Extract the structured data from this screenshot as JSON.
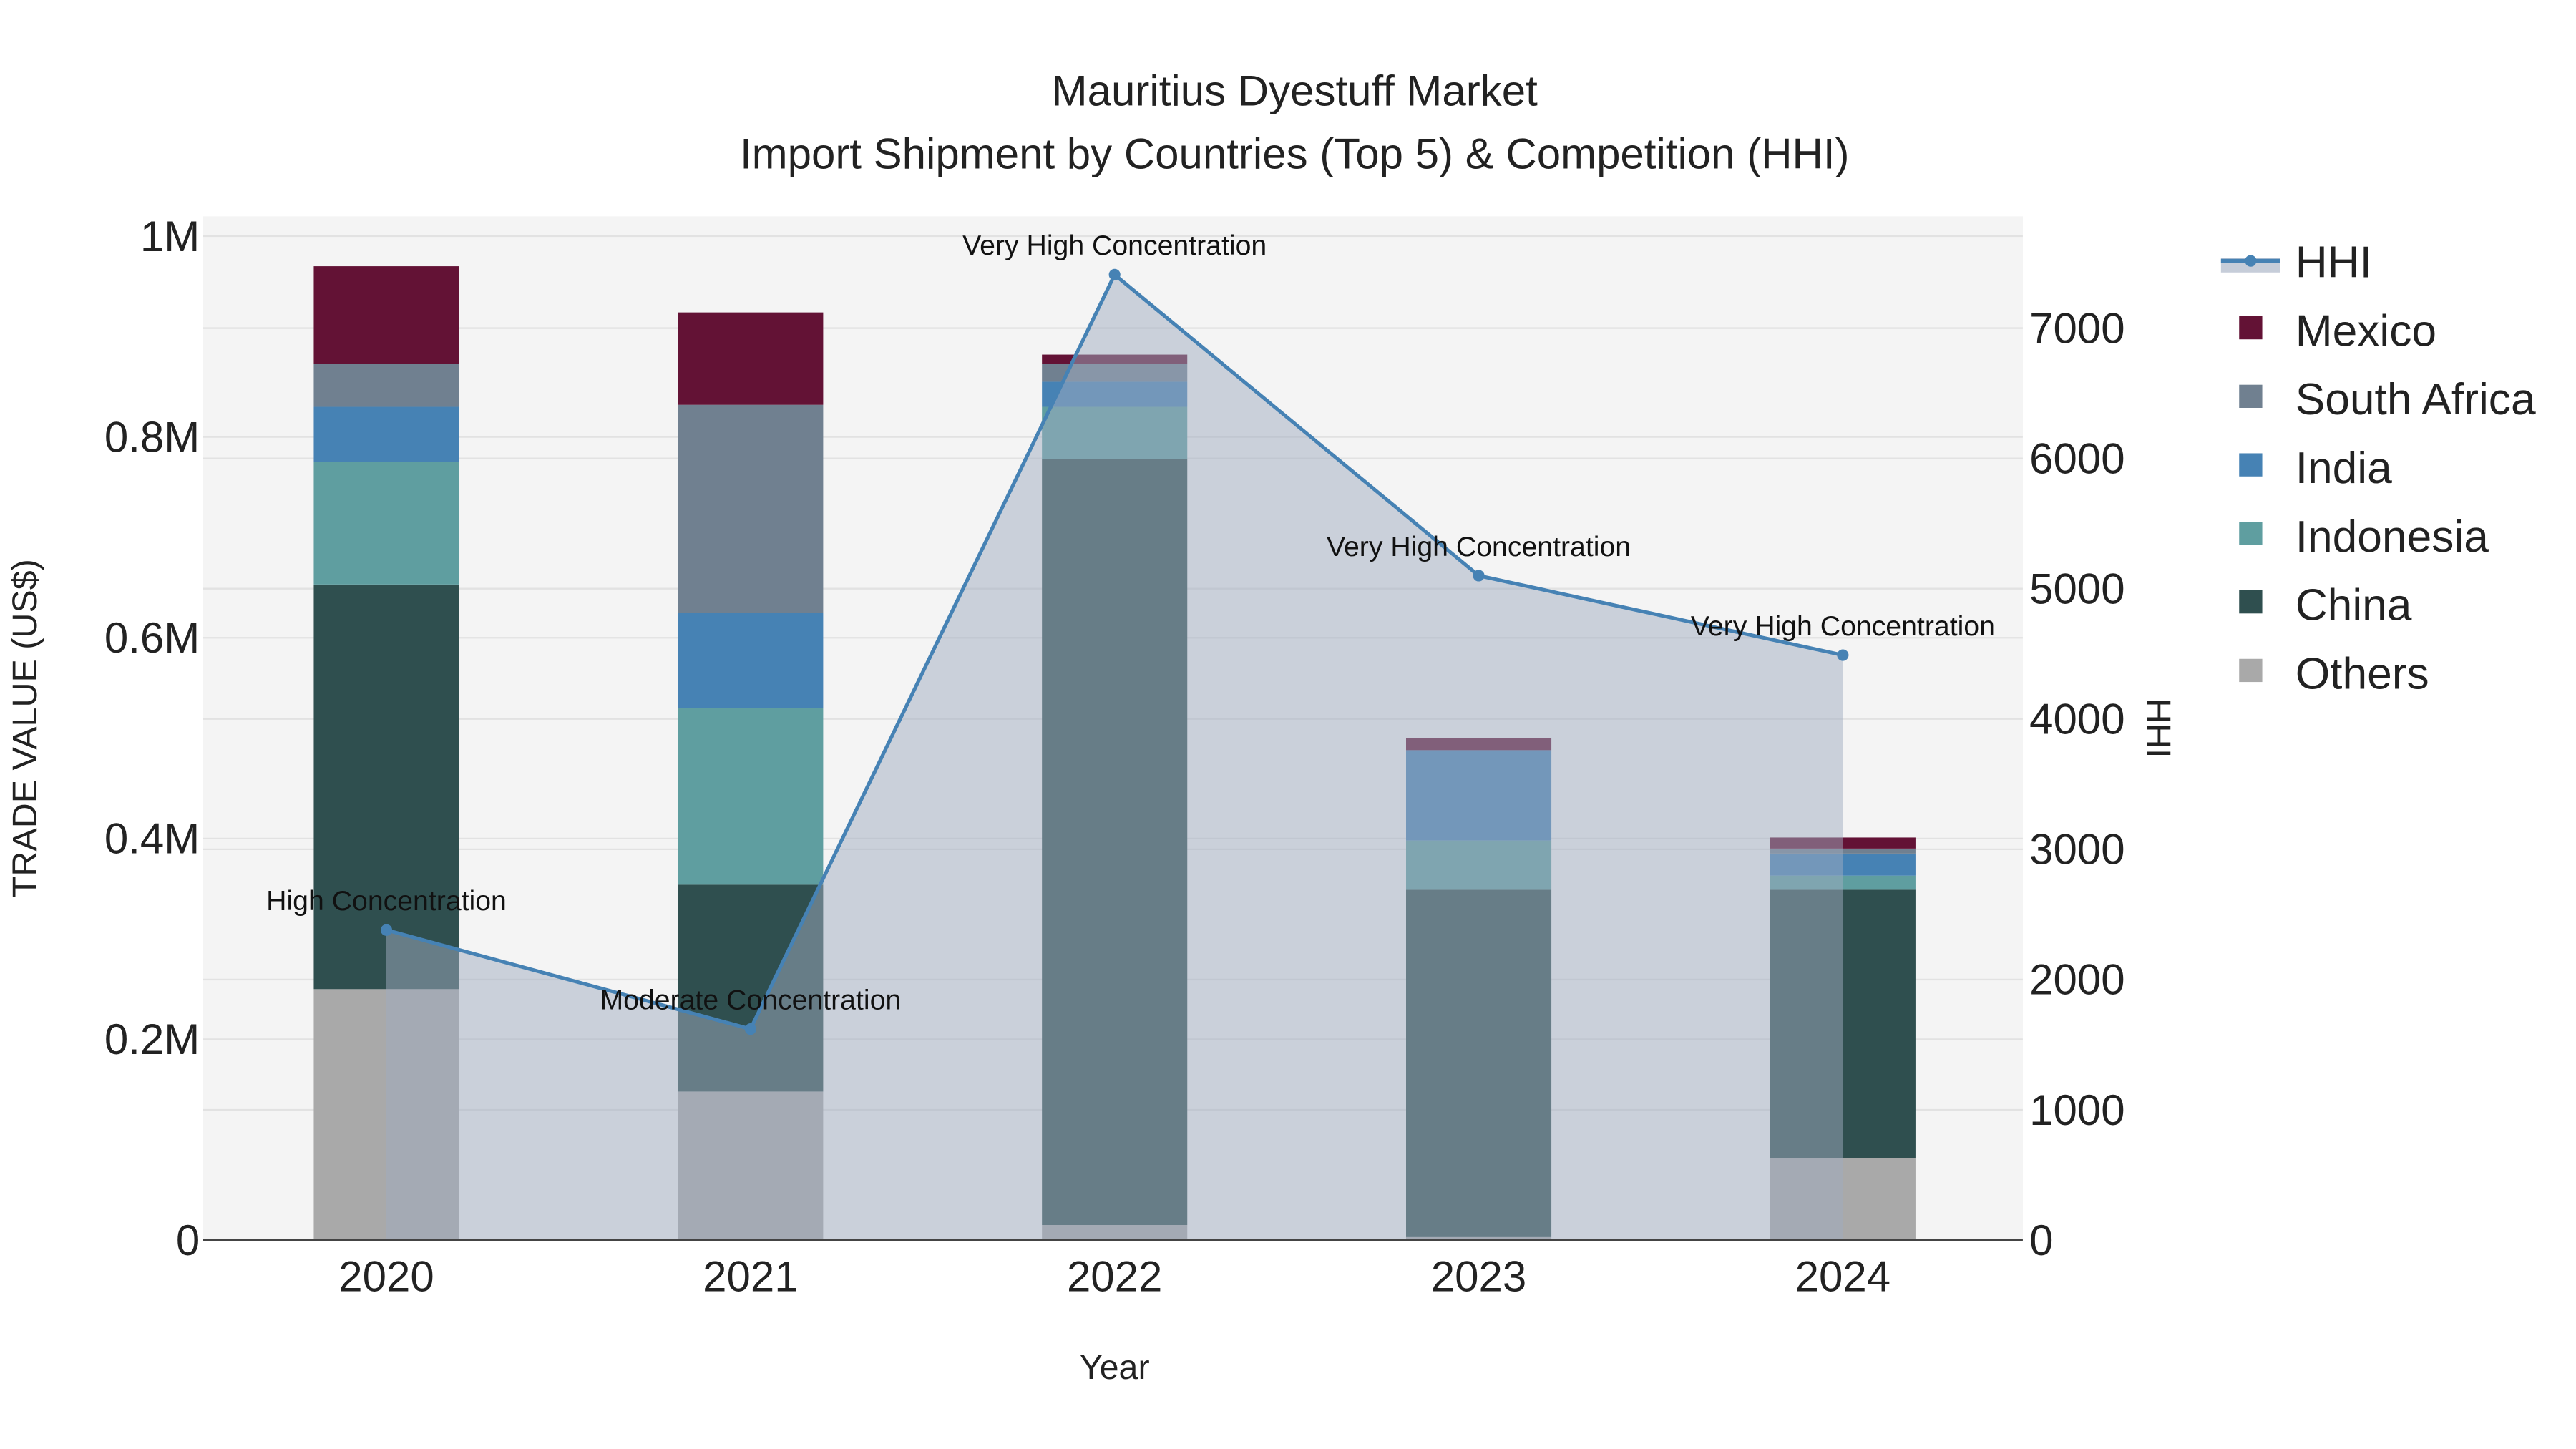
{
  "chart_data": {
    "type": "bar",
    "title": "Mauritius Dyestuff Market",
    "subtitle": "Import Shipment by Countries (Top 5) & Competition (HHI)",
    "xlabel": "Year",
    "ylabel": "TRADE VALUE (US$)",
    "y2label": "HHI",
    "categories": [
      "2020",
      "2021",
      "2022",
      "2023",
      "2024"
    ],
    "ylim": [
      0,
      1000000
    ],
    "y2lim": [
      0,
      7800
    ],
    "yticks": [
      {
        "v": 0,
        "label": "0"
      },
      {
        "v": 200000,
        "label": "0.2M"
      },
      {
        "v": 400000,
        "label": "0.4M"
      },
      {
        "v": 600000,
        "label": "0.6M"
      },
      {
        "v": 800000,
        "label": "0.8M"
      },
      {
        "v": 1000000,
        "label": "1M"
      }
    ],
    "y2ticks": [
      0,
      1000,
      2000,
      3000,
      4000,
      5000,
      6000,
      7000
    ],
    "series": [
      {
        "name": "Others",
        "color": "#a9a9a9",
        "values": [
          250000,
          148000,
          15000,
          3000,
          82000
        ]
      },
      {
        "name": "China",
        "color": "#2f4f4f",
        "values": [
          403000,
          206000,
          763000,
          346000,
          267000
        ]
      },
      {
        "name": "Indonesia",
        "color": "#5f9ea0",
        "values": [
          122000,
          176000,
          52000,
          49000,
          14000
        ]
      },
      {
        "name": "India",
        "color": "#4682b4",
        "values": [
          55000,
          95000,
          25000,
          90000,
          22000
        ]
      },
      {
        "name": "South Africa",
        "color": "#708090",
        "values": [
          43000,
          207000,
          18000,
          0,
          5000
        ]
      },
      {
        "name": "Mexico",
        "color": "#631235",
        "values": [
          97000,
          92000,
          9000,
          12000,
          11000
        ]
      }
    ],
    "hhi": {
      "name": "HHI",
      "color": "#4682b4",
      "values": [
        2380,
        1620,
        7410,
        5100,
        4490
      ],
      "annotations": [
        "High Concentration",
        "Moderate Concentration",
        "Very High Concentration",
        "Very High Concentration",
        "Very High Concentration"
      ]
    },
    "legend": {
      "placement": "right",
      "order": [
        "HHI",
        "Mexico",
        "South Africa",
        "India",
        "Indonesia",
        "China",
        "Others"
      ]
    },
    "grid": true
  }
}
